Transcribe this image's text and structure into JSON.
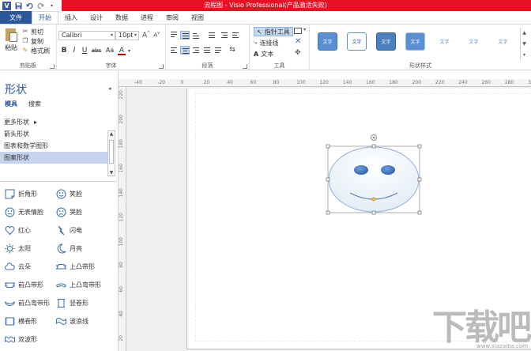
{
  "window": {
    "title": "流程图 - Visio Professional(产品激活失败)"
  },
  "quick_access": {
    "app_icon": "visio-logo-icon",
    "save_icon": "save-icon",
    "undo_icon": "undo-icon",
    "redo_icon": "redo-icon",
    "customize_icon": "customize-qat-icon",
    "logo_letter": "V"
  },
  "tabs": [
    {
      "label": "文件"
    },
    {
      "label": "开始"
    },
    {
      "label": "插入"
    },
    {
      "label": "设计"
    },
    {
      "label": "数据"
    },
    {
      "label": "进程"
    },
    {
      "label": "审阅"
    },
    {
      "label": "视图"
    }
  ],
  "ribbon": {
    "clipboard": {
      "group_label": "剪贴板",
      "paste_label": "粘贴",
      "cut_label": "剪切",
      "copy_label": "复制",
      "format_painter_label": "格式刷"
    },
    "font": {
      "group_label": "字体",
      "font_name": "Calibri",
      "font_size": "10pt",
      "grow": "A",
      "shrink": "A",
      "bold": "B",
      "italic": "I",
      "underline": "U",
      "strike": "abc",
      "case": "Aa",
      "color": "A"
    },
    "paragraph": {
      "group_label": "段落"
    },
    "tools": {
      "group_label": "工具",
      "pointer_label": "指针工具",
      "connector_label": "连接线",
      "text_label": "文本"
    },
    "shape_styles": {
      "group_label": "形状样式",
      "swatch_text": "文字",
      "swatches": [
        {
          "bg": "#5b8fd4",
          "fg": "#ffffff",
          "border": "#3f73b7"
        },
        {
          "bg": "#ffffff",
          "fg": "#2b579a",
          "border": "#5b8fd4"
        },
        {
          "bg": "#4a7fc0",
          "fg": "#ffffff",
          "border": "#35619c"
        },
        {
          "bg": "#5b8fd4",
          "fg": "#ffffff",
          "border": "#9bbbe6"
        },
        {
          "bg": "#ffffff",
          "fg": "#5b8fd4",
          "border": "#ffffff"
        },
        {
          "bg": "#ffffff",
          "fg": "#5b8fd4",
          "border": "#ffffff"
        },
        {
          "bg": "#ffffff",
          "fg": "#5b8fd4",
          "border": "#ffffff"
        }
      ]
    }
  },
  "shapes_pane": {
    "title": "形状",
    "tab_stencils": "模具",
    "tab_search": "搜索",
    "stencils": [
      {
        "label": "更多形状",
        "has_arrow": true
      },
      {
        "label": "箭头形状"
      },
      {
        "label": "图表和数学图形"
      },
      {
        "label": "图案形状",
        "selected": true
      }
    ],
    "more_arrow": "▸",
    "masters": [
      {
        "label": "折角形",
        "icon": "folded-corner-icon"
      },
      {
        "label": "笑脸",
        "icon": "smiley-icon"
      },
      {
        "label": "无表情脸",
        "icon": "neutral-face-icon"
      },
      {
        "label": "哭脸",
        "icon": "sad-face-icon"
      },
      {
        "label": "红心",
        "icon": "heart-icon"
      },
      {
        "label": "闪电",
        "icon": "lightning-icon"
      },
      {
        "label": "太阳",
        "icon": "sun-icon"
      },
      {
        "label": "月亮",
        "icon": "moon-icon"
      },
      {
        "label": "云朵",
        "icon": "cloud-icon"
      },
      {
        "label": "上凸带形",
        "icon": "ribbon-up-icon"
      },
      {
        "label": "前凸带形",
        "icon": "ribbon-front-icon"
      },
      {
        "label": "上凸弯带形",
        "icon": "curved-ribbon-up-icon"
      },
      {
        "label": "前凸弯带形",
        "icon": "curved-ribbon-front-icon"
      },
      {
        "label": "竖卷形",
        "icon": "vertical-scroll-icon"
      },
      {
        "label": "横卷形",
        "icon": "horizontal-scroll-icon"
      },
      {
        "label": "波浪线",
        "icon": "wave-icon"
      },
      {
        "label": "双波形",
        "icon": "double-wave-icon"
      }
    ]
  },
  "rulers": {
    "top_labels": [
      "-40",
      "-20",
      "0",
      "20",
      "40",
      "60",
      "80",
      "100",
      "120",
      "140",
      "160",
      "180",
      "200",
      "220",
      "240",
      "260",
      "280",
      "300"
    ],
    "left_labels": [
      "220",
      "200",
      "180",
      "160",
      "140",
      "120",
      "100",
      "80",
      "60",
      "40",
      "20"
    ]
  },
  "watermark": {
    "text": "下载吧",
    "sub": "www.xiazaiba.com"
  }
}
